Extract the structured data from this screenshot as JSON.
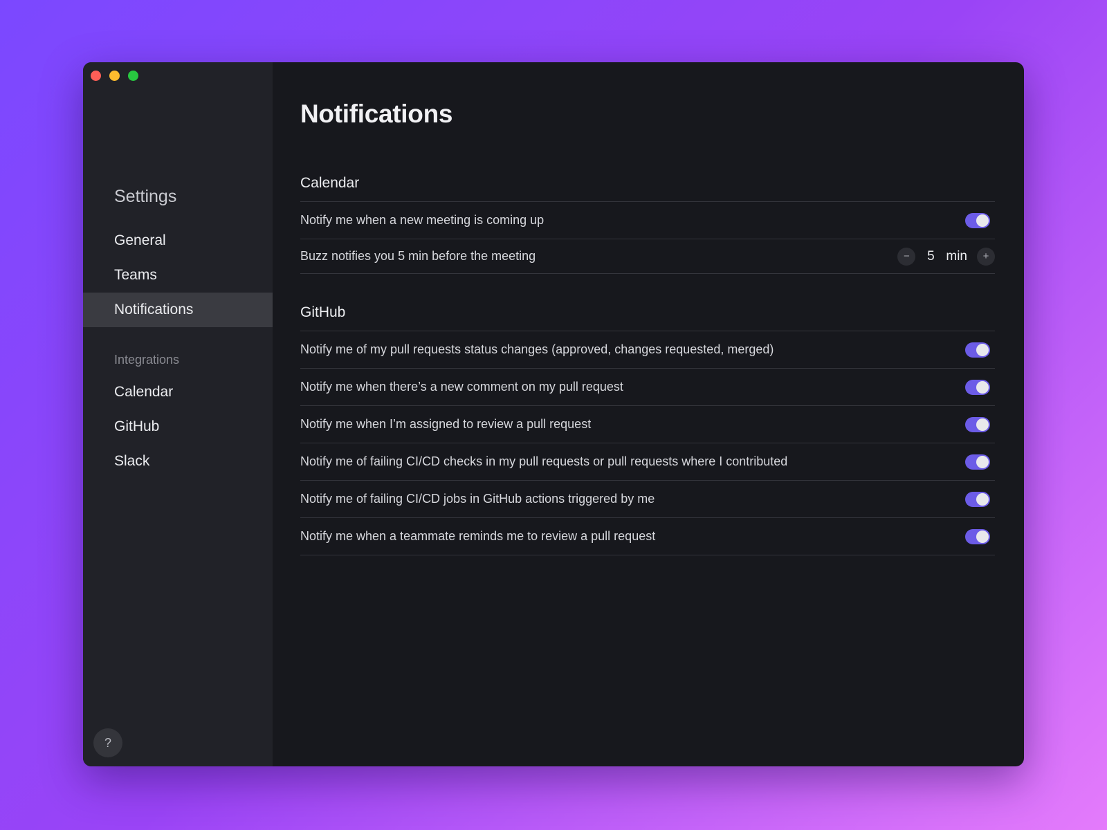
{
  "sidebar": {
    "title": "Settings",
    "items": [
      {
        "label": "General"
      },
      {
        "label": "Teams"
      },
      {
        "label": "Notifications"
      }
    ],
    "section_label": "Integrations",
    "integrations": [
      {
        "label": "Calendar"
      },
      {
        "label": "GitHub"
      },
      {
        "label": "Slack"
      }
    ],
    "help_label": "?"
  },
  "main": {
    "title": "Notifications",
    "calendar": {
      "title": "Calendar",
      "rows": [
        {
          "label": "Notify me when a new meeting is coming up",
          "enabled": true
        },
        {
          "label": "Buzz notifies you 5 min before the meeting"
        }
      ],
      "stepper": {
        "minus": "−",
        "value": "5",
        "unit": "min",
        "plus": "+"
      }
    },
    "github": {
      "title": "GitHub",
      "rows": [
        {
          "label": "Notify me of my pull requests status changes (approved, changes requested, merged)",
          "enabled": true
        },
        {
          "label": "Notify me when there’s a new comment on my pull request",
          "enabled": true
        },
        {
          "label": "Notify me when I’m assigned to review a pull request",
          "enabled": true
        },
        {
          "label": "Notify me of failing CI/CD checks in my pull requests or pull requests where I contributed",
          "enabled": true
        },
        {
          "label": "Notify me of failing CI/CD jobs in GitHub actions triggered by me",
          "enabled": true
        },
        {
          "label": "Notify me when a teammate reminds me to review a pull request",
          "enabled": true
        }
      ]
    }
  },
  "colors": {
    "accent": "#6c5ce7",
    "window_bg": "#17181d",
    "sidebar_bg": "#212228"
  }
}
